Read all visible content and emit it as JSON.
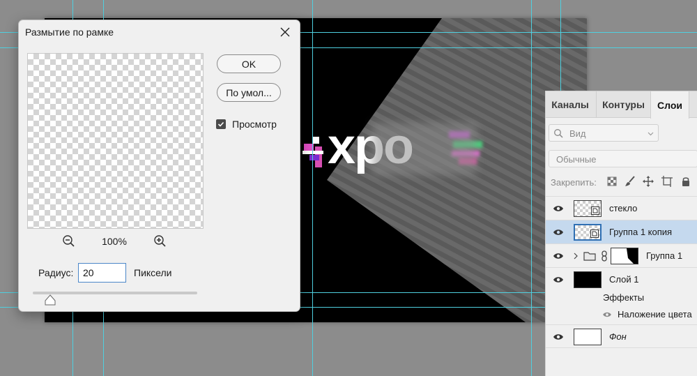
{
  "dialog": {
    "title": "Размытие по рамке",
    "close_icon": "close-icon",
    "ok_label": "OK",
    "default_label": "По умол...",
    "preview_label": "Просмотр",
    "preview_checked": true,
    "zoom_value": "100%",
    "radius_label": "Радиус:",
    "radius_value": "20",
    "radius_unit": "Пиксели"
  },
  "canvas": {
    "text": "xpo"
  },
  "layers_panel": {
    "tabs": [
      {
        "label": "Каналы",
        "active": false
      },
      {
        "label": "Контуры",
        "active": false
      },
      {
        "label": "Слои",
        "active": true
      }
    ],
    "filter_placeholder": "Вид",
    "blend_mode": "Обычные",
    "lock_label": "Закрепить:",
    "layers": [
      {
        "name": "стекло",
        "visible": true,
        "selected": false,
        "thumb": "checker-smart"
      },
      {
        "name": "Группа 1 копия",
        "visible": true,
        "selected": true,
        "thumb": "checker-smart"
      },
      {
        "name": "Группа 1",
        "visible": true,
        "selected": false,
        "thumb": "group-mask"
      },
      {
        "name": "Слой 1",
        "visible": true,
        "selected": false,
        "thumb": "black"
      },
      {
        "name": "Эффекты"
      },
      {
        "name": "Наложение цвета",
        "visible": true
      },
      {
        "name": "Фон",
        "visible": true,
        "selected": false,
        "thumb": "white"
      }
    ]
  },
  "colors": {
    "selection": "#c5d9ee",
    "guide": "#4fd0e0",
    "workspace": "#8c8c8c"
  }
}
